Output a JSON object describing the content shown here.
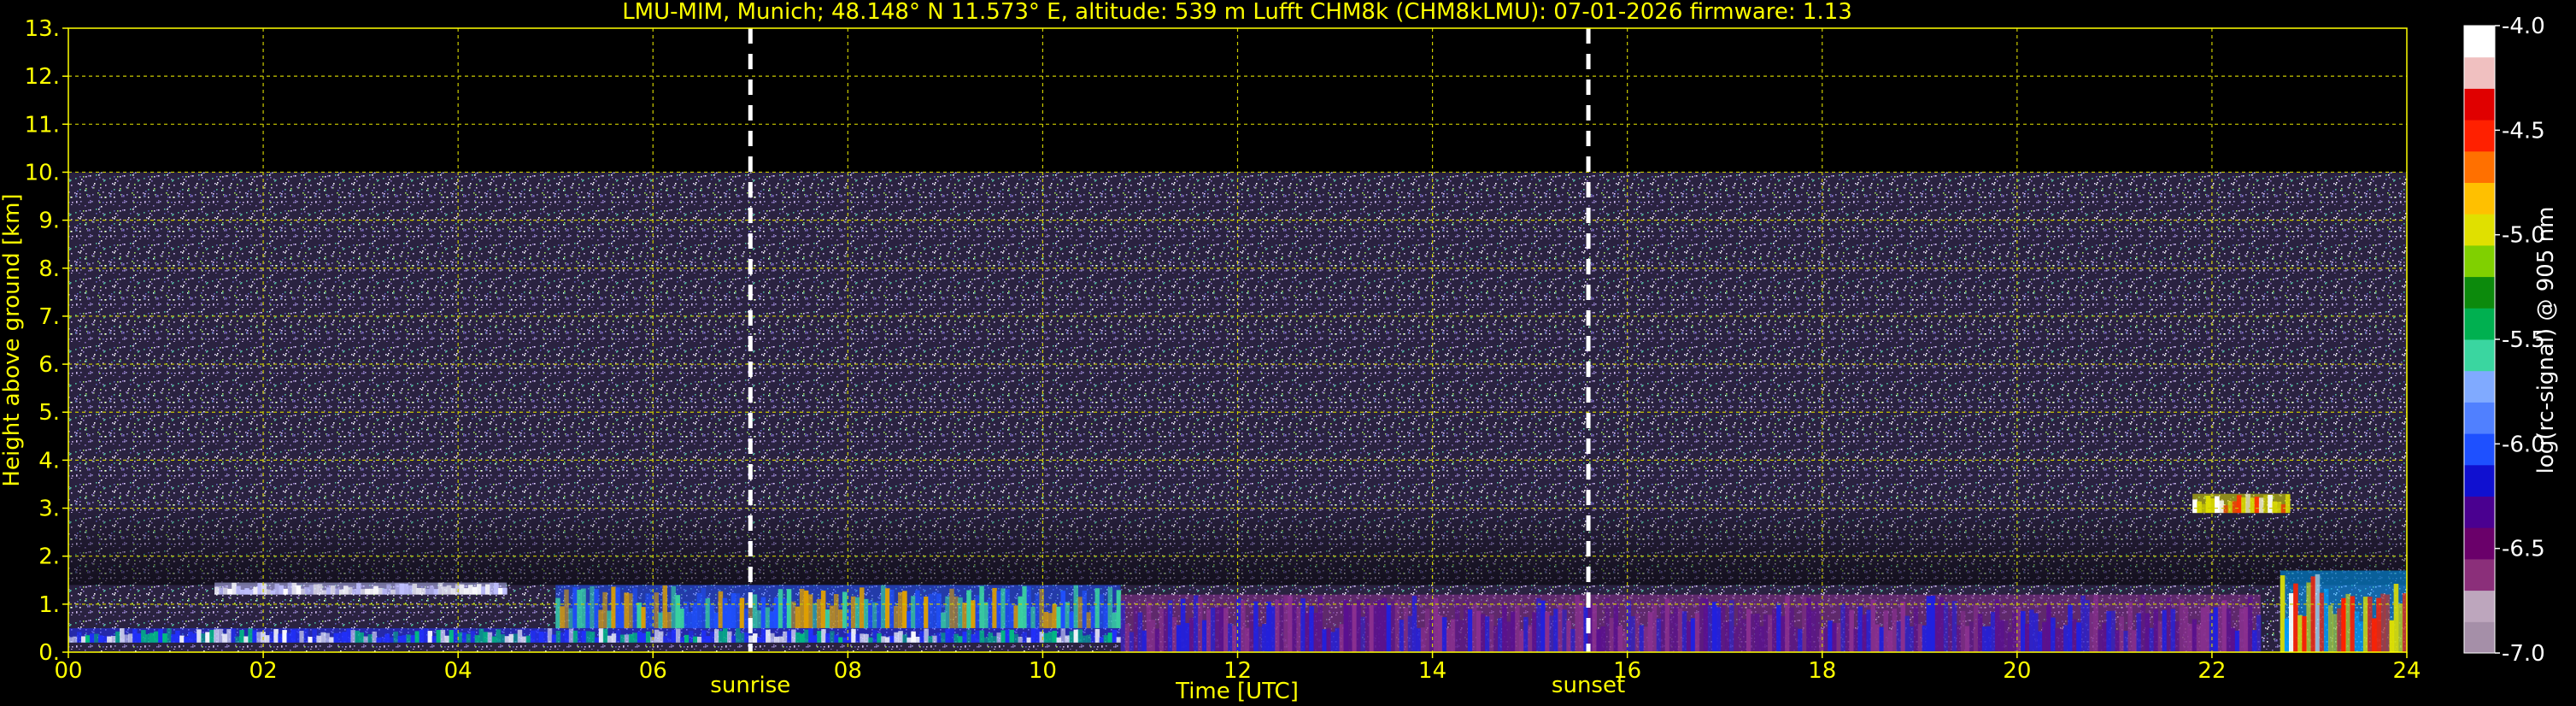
{
  "chart_data": {
    "type": "heatmap",
    "title": "LMU-MIM, Munich; 48.148° N 11.573° E, altitude: 539 m    Lufft CHM8k (CHM8kLMU): 07-01-2026    firmware: 1.13",
    "xlabel": "Time [UTC]",
    "ylabel": "Height above ground [km]",
    "xlim": [
      0,
      24
    ],
    "ylim": [
      0,
      13
    ],
    "x_ticks": [
      "00",
      "02",
      "04",
      "06",
      "08",
      "10",
      "12",
      "14",
      "16",
      "18",
      "20",
      "22",
      "24"
    ],
    "y_ticks": [
      "0.",
      "1.",
      "2.",
      "3.",
      "4.",
      "5.",
      "6.",
      "7.",
      "8.",
      "9.",
      "10.",
      "11.",
      "12.",
      "13."
    ],
    "grid": true,
    "measurement_top_km": 10,
    "sunrise_hour": 7.0,
    "sunset_hour": 15.6,
    "sunrise_label": "sunrise",
    "sunset_label": "sunset",
    "colorbar": {
      "label": "log(rc-signal) @ 905 nm",
      "range": [
        -7.0,
        -4.0
      ],
      "ticks": [
        "-4.0",
        "-4.5",
        "-5.0",
        "-5.5",
        "-6.0",
        "-6.5",
        "-7.0"
      ],
      "tick_values": [
        -4.0,
        -4.5,
        -5.0,
        -5.5,
        -6.0,
        -6.5,
        -7.0
      ]
    },
    "features": [
      {
        "name": "boundary-layer",
        "t0": 0.0,
        "t1": 10.8,
        "h": [
          0.2,
          0.5
        ]
      },
      {
        "name": "aerosol-layer",
        "t0": 5.0,
        "t1": 10.8,
        "h": [
          0.5,
          1.4
        ]
      },
      {
        "name": "sparse-cloud",
        "t0": 1.5,
        "t1": 4.5,
        "h": [
          1.2,
          1.45
        ]
      },
      {
        "name": "residual-layer",
        "t0": 10.8,
        "t1": 22.5,
        "h": [
          0.0,
          1.2
        ]
      },
      {
        "name": "cloud-aloft",
        "t0": 21.8,
        "t1": 22.8,
        "h": [
          2.9,
          3.3
        ]
      },
      {
        "name": "low-cloud-end",
        "t0": 22.7,
        "t1": 24.0,
        "h": [
          0.0,
          1.7
        ]
      }
    ]
  },
  "colors": {
    "text": "#ffff00",
    "grid": "#cccc00",
    "background": "#000000",
    "noise": "#5a4f7e",
    "sun_lines": "#ffffff",
    "colormap": [
      "#a58fa8",
      "#bda6bd",
      "#8b2f7a",
      "#6a006a",
      "#4a0090",
      "#1010d0",
      "#1e50ff",
      "#5080ff",
      "#80aaff",
      "#3ad6a0",
      "#00b050",
      "#0c8a0c",
      "#80d000",
      "#e0e000",
      "#ffc000",
      "#ff7000",
      "#ff2000",
      "#e00000",
      "#f0c0c0",
      "#ffffff"
    ]
  }
}
